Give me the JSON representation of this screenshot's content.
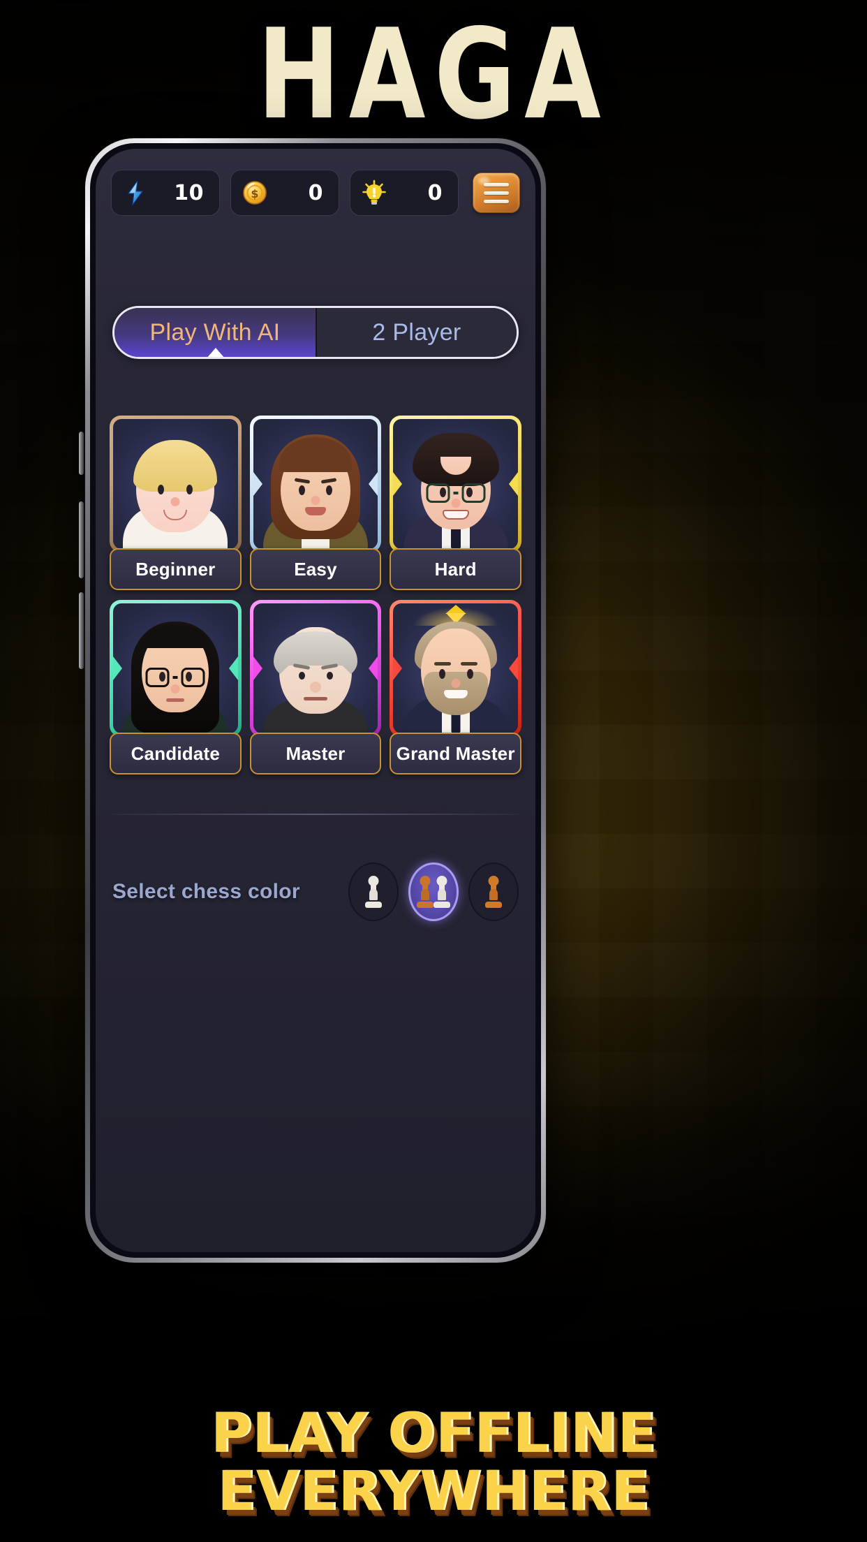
{
  "app_title": "HAGA",
  "status_bar": {
    "counters": [
      {
        "icon": "lightning-bolt-icon",
        "value": "10",
        "color": "#4da6f0"
      },
      {
        "icon": "gold-coin-icon",
        "value": "0",
        "color": "#f0b429"
      },
      {
        "icon": "lightbulb-hint-icon",
        "value": "0",
        "color": "#f5d130"
      }
    ],
    "menu_button": "hamburger-menu-icon"
  },
  "mode_toggle": {
    "active_index": 0,
    "tabs": [
      {
        "label": "Play With AI",
        "state": "active",
        "text_color": "#f0b878"
      },
      {
        "label": "2 Player",
        "state": "inactive",
        "text_color": "#a9bbe8"
      }
    ]
  },
  "difficulty": {
    "cards": [
      {
        "label": "Beginner",
        "frame_color": "#c89f77",
        "frame_color2": "#a07a55",
        "notch": false,
        "crown": false,
        "avatar": {
          "hair": "#f0d48a",
          "hair2": "#e0c070",
          "skin": "#fbddd2",
          "body": "#f6f1ea",
          "style": "short-blond",
          "mouth": "smile"
        }
      },
      {
        "label": "Easy",
        "frame_color": "#dceaf7",
        "frame_color2": "#a9cce8",
        "notch": true,
        "crown": false,
        "avatar": {
          "hair": "#7a4426",
          "hair2": "#5e3119",
          "skin": "#f4c9ab",
          "body": "#6b5a2e",
          "style": "long-brown",
          "mouth": "smirk"
        }
      },
      {
        "label": "Hard",
        "frame_color": "#f8e36a",
        "frame_color2": "#e0c53a",
        "notch": true,
        "crown": false,
        "avatar": {
          "hair": "#2a1d1a",
          "hair2": "#1c1312",
          "skin": "#f6c9b4",
          "body": "#2e2c48",
          "style": "curly-dark",
          "glasses": true,
          "mouth": "teeth"
        }
      },
      {
        "label": "Candidate",
        "frame_color": "#5fe9bd",
        "frame_color2": "#2fc79b",
        "notch": true,
        "crown": false,
        "avatar": {
          "hair": "#120f0e",
          "hair2": "#0a0807",
          "skin": "#f4cbac",
          "body": "#1d3028",
          "style": "long-black",
          "glasses": true,
          "mouth": "flat"
        }
      },
      {
        "label": "Master",
        "frame_color": "#f55df0",
        "frame_color2": "#c033c9",
        "notch": true,
        "crown": false,
        "avatar": {
          "hair": "#cfcbc4",
          "hair2": "#b0aca4",
          "skin": "#f2ded0",
          "body": "#2c2b2e",
          "style": "bald-gray",
          "mouth": "frown"
        }
      },
      {
        "label": "Grand Master",
        "frame_color": "#f9564a",
        "frame_color2": "#e03020",
        "notch": true,
        "crown": true,
        "avatar": {
          "hair": "#b8a386",
          "hair2": "#9d8668",
          "skin": "#f5cdb0",
          "body": "#242742",
          "style": "bearded",
          "beard": true,
          "mouth": "teeth"
        }
      }
    ]
  },
  "chess_color": {
    "label": "Select chess color",
    "selected_index": 1,
    "options": [
      {
        "name": "white-pawn-option",
        "pieces": [
          "white"
        ]
      },
      {
        "name": "random-pawn-option",
        "pieces": [
          "brown",
          "white"
        ]
      },
      {
        "name": "brown-pawn-option",
        "pieces": [
          "brown"
        ]
      }
    ]
  },
  "bottom_banner": {
    "line1": "PLAY OFFLINE",
    "line2": "EVERYWHERE"
  },
  "theme": {
    "screen_bg": "#272636",
    "accent_orange": "#e2913a",
    "accent_purple": "#5a45d0",
    "banner_yellow": "#fbd34a"
  }
}
